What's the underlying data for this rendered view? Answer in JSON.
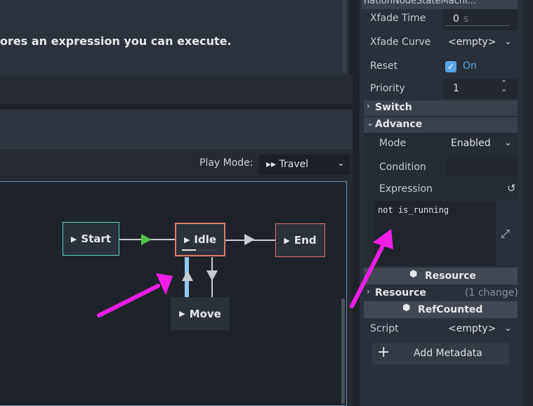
{
  "description": {
    "text": "ores an expression you can execute."
  },
  "state_machine": {
    "play_mode_label": "Play Mode:",
    "play_mode_value": "▸▸ Travel",
    "nodes": {
      "start": "Start",
      "idle": "Idle",
      "end": "End",
      "move": "Move"
    }
  },
  "inspector": {
    "title": "nationNodeStateMachi...",
    "xfade_time": {
      "label": "Xfade Time",
      "value": "0",
      "unit": "s"
    },
    "xfade_curve": {
      "label": "Xfade Curve",
      "value": "<empty>"
    },
    "reset": {
      "label": "Reset",
      "value": "On"
    },
    "priority": {
      "label": "Priority",
      "value": "1"
    },
    "switch_section": "Switch",
    "advance_section": "Advance",
    "mode": {
      "label": "Mode",
      "value": "Enabled"
    },
    "condition": {
      "label": "Condition",
      "value": ""
    },
    "expression": {
      "label": "Expression",
      "value": "not is_running"
    },
    "resource_header": "Resource",
    "resource_section": "Resource",
    "resource_changes": "(1 change)",
    "refcounted_header": "RefCounted",
    "script": {
      "label": "Script",
      "value": "<empty>"
    },
    "add_metadata": "Add Metadata"
  },
  "colors": {
    "accent": "#5aa6e8",
    "annotation_arrow": "#f21ee8",
    "start_node_border": "#5fd3c4",
    "state_node_border": "#e0776c",
    "travel_arrow": "#55c24d"
  }
}
